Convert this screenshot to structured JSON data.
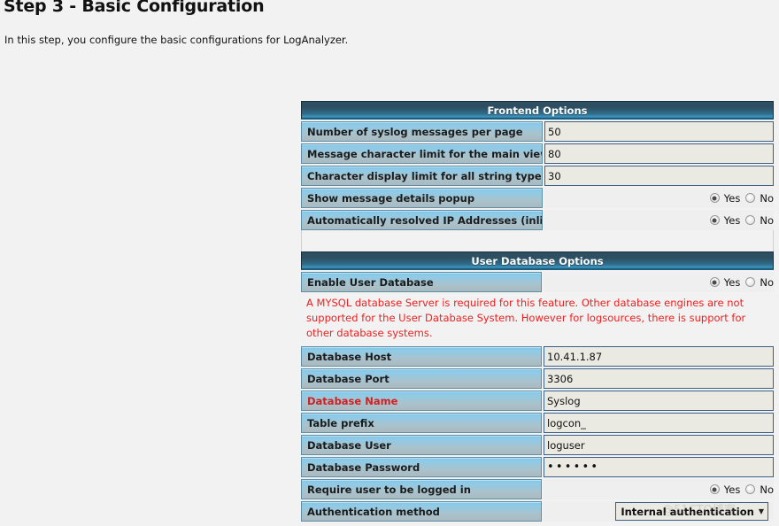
{
  "page": {
    "title": "Step 3 - Basic Configuration",
    "intro": "In this step, you configure the basic configurations for LogAnalyzer.",
    "watermark": "@51CTO博客"
  },
  "colors": {
    "header_dark": "#2d4f61",
    "header_light": "#3e93bb",
    "label_top": "#7fc5e6",
    "label_bottom": "#aab9bf",
    "input_bg": "#eaeae2",
    "input_border": "#3c5f85",
    "warning_red": "#ef2020",
    "page_bg": "#f2f2f2"
  },
  "frontend": {
    "header": "Frontend Options",
    "rows": [
      {
        "label": "Number of syslog messages per page",
        "type": "text",
        "value": "50"
      },
      {
        "label": "Message character limit for the main view",
        "type": "text",
        "value": "80"
      },
      {
        "label": "Character display limit for all string type fields",
        "type": "text",
        "value": "30"
      },
      {
        "label": "Show message details popup",
        "type": "radio",
        "yes_label": "Yes",
        "no_label": "No",
        "selected": "Yes"
      },
      {
        "label": "Automatically resolved IP Addresses (inline)",
        "type": "radio",
        "yes_label": "Yes",
        "no_label": "No",
        "selected": "Yes"
      }
    ]
  },
  "userdb": {
    "header": "User Database Options",
    "enable": {
      "label": "Enable User Database",
      "yes_label": "Yes",
      "no_label": "No",
      "selected": "Yes"
    },
    "notice": "A MYSQL database Server is required for this feature. Other database engines are not supported for the User Database System. However for logsources, there is support for other database systems.",
    "rows": [
      {
        "label": "Database Host",
        "type": "text",
        "value": "10.41.1.87",
        "red": false
      },
      {
        "label": "Database Port",
        "type": "text",
        "value": "3306",
        "red": false
      },
      {
        "label": "Database Name",
        "type": "text",
        "value": "Syslog",
        "red": true
      },
      {
        "label": "Table prefix",
        "type": "text",
        "value": "logcon_",
        "red": false
      },
      {
        "label": "Database User",
        "type": "text",
        "value": "loguser",
        "red": false
      },
      {
        "label": "Database Password",
        "type": "password",
        "value": "••••••",
        "red": false
      },
      {
        "label": "Require user to be logged in",
        "type": "radio",
        "yes_label": "Yes",
        "no_label": "No",
        "selected": "Yes",
        "red": false
      },
      {
        "label": "Authentication method",
        "type": "select",
        "value": "Internal authentication",
        "red": false
      }
    ]
  }
}
